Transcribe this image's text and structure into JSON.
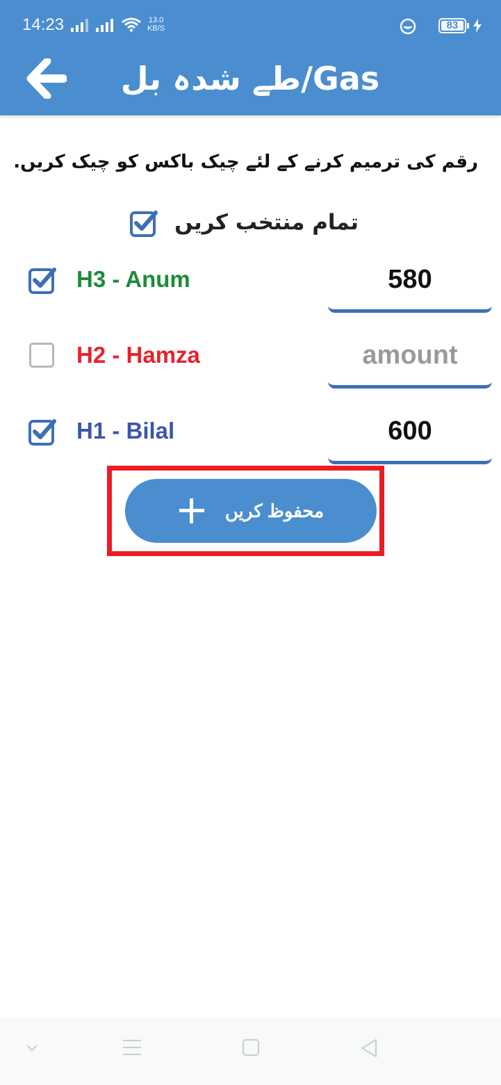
{
  "status_bar": {
    "time": "14:23",
    "net_speed_value": "13.0",
    "net_speed_unit": "KB/S",
    "battery": "83"
  },
  "header": {
    "title": "طے شدہ بل/Gas",
    "back_icon": "arrow-left-icon"
  },
  "instruction": "رقم کی ترمیم کرنے کے لئے چیک باکس کو چیک کریں.",
  "select_all": {
    "label": "تمام منتخب کریں",
    "checked": true
  },
  "rows": [
    {
      "name": "H3 - Anum",
      "name_color": "#1e8c3a",
      "checked": true,
      "amount": "580",
      "placeholder": "amount"
    },
    {
      "name": "H2 - Hamza",
      "name_color": "#e8222e",
      "checked": false,
      "amount": "",
      "placeholder": "amount"
    },
    {
      "name": "H1 - Bilal",
      "name_color": "#3a58a8",
      "checked": true,
      "amount": "600",
      "placeholder": "amount"
    }
  ],
  "save_button": {
    "label": "محفوظ کریں",
    "icon": "plus-icon"
  },
  "colors": {
    "primary": "#4a8ecf",
    "checkbox": "#3d6fb6",
    "highlight": "#ec1c24"
  },
  "nav_bar": {
    "icons": [
      "chevron-down-icon",
      "menu-icon",
      "home-square-icon",
      "back-triangle-icon"
    ]
  }
}
